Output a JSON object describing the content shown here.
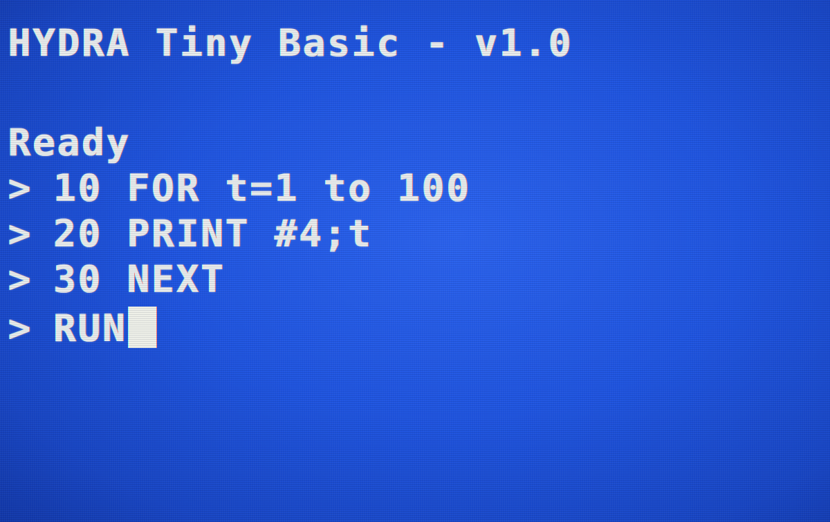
{
  "terminal": {
    "banner": "HYDRA Tiny Basic - v1.0",
    "status": "Ready",
    "prompt": ">",
    "lines": [
      "10 FOR t=1 to 100",
      "20 PRINT #4;t",
      "30 NEXT",
      "RUN"
    ]
  },
  "colors": {
    "background": "#1f55e0",
    "foreground": "#e8ecec",
    "cursor": "#eef0e8"
  }
}
